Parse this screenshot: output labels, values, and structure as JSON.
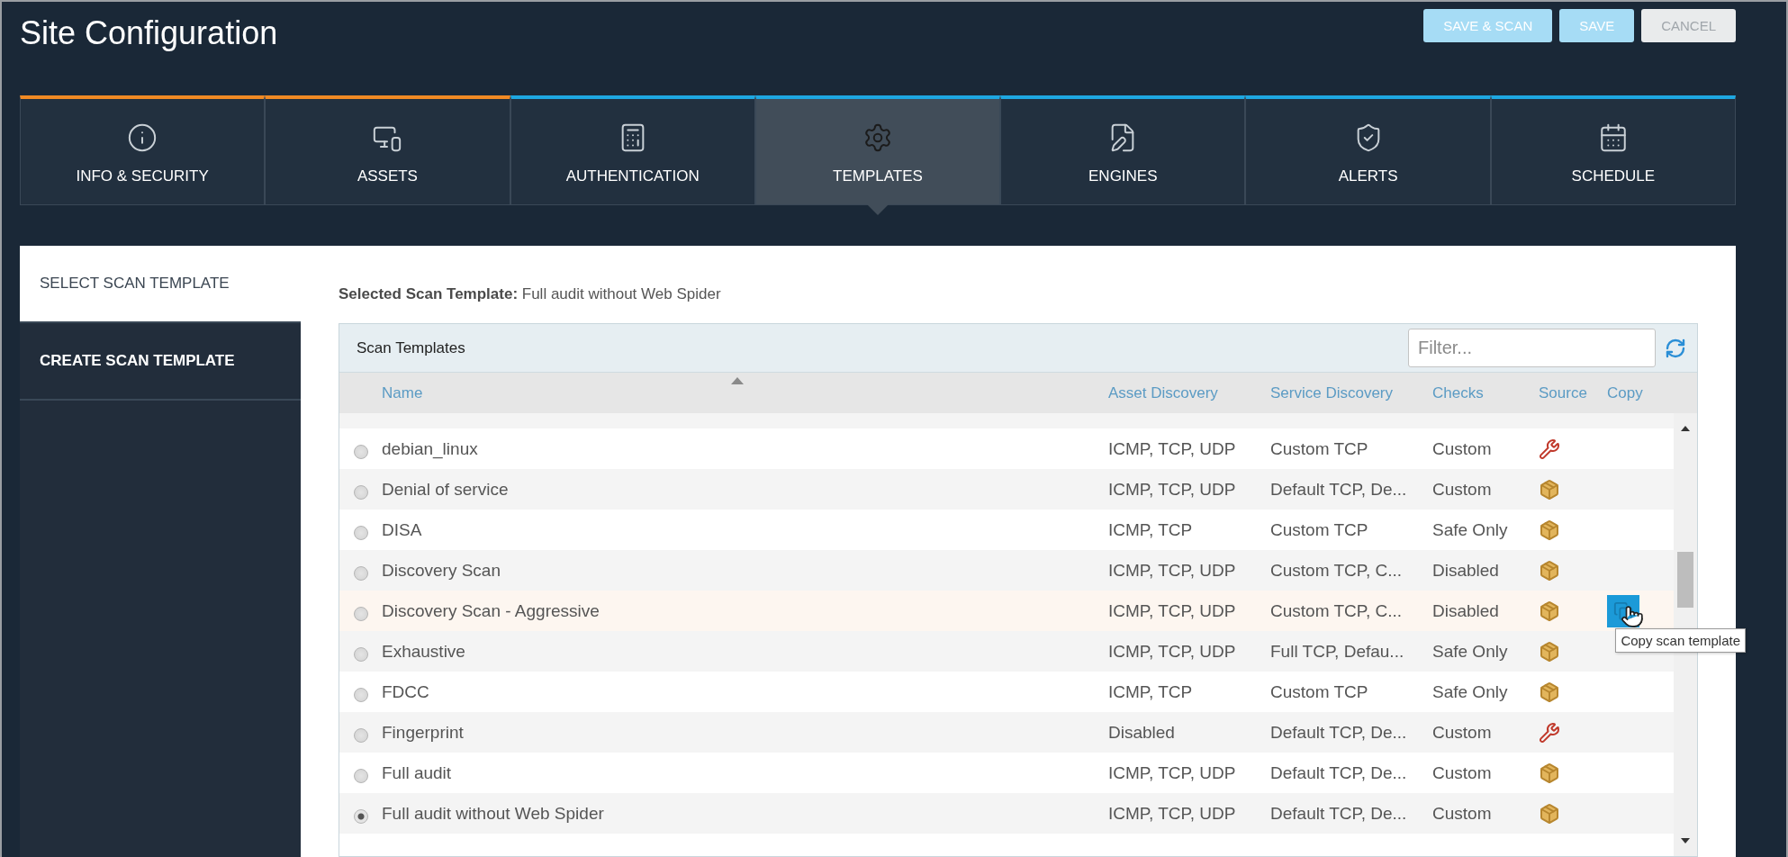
{
  "title": "Site Configuration",
  "actions": [
    {
      "label": "SAVE & SCAN",
      "kind": "primary"
    },
    {
      "label": "SAVE",
      "kind": "primary"
    },
    {
      "label": "CANCEL",
      "kind": "secondary"
    }
  ],
  "tabs": [
    {
      "label": "INFO & SECURITY",
      "selected": false,
      "color": "#f08a24"
    },
    {
      "label": "ASSETS",
      "selected": false,
      "color": "#f08a24"
    },
    {
      "label": "AUTHENTICATION",
      "selected": false,
      "color": "#1ea7e1"
    },
    {
      "label": "TEMPLATES",
      "selected": true,
      "color": "#1ea7e1"
    },
    {
      "label": "ENGINES",
      "selected": false,
      "color": "#1ea7e1"
    },
    {
      "label": "ALERTS",
      "selected": false,
      "color": "#1ea7e1"
    },
    {
      "label": "SCHEDULE",
      "selected": false,
      "color": "#1ea7e1"
    }
  ],
  "sidebar": {
    "items": [
      {
        "label": "SELECT SCAN TEMPLATE",
        "selected": true
      },
      {
        "label": "CREATE SCAN TEMPLATE",
        "selected": false
      }
    ]
  },
  "selected_template": "**Selected Scan Template:** Full audit without Web Spider",
  "table": {
    "title": "Scan Templates",
    "filter": {
      "placeholder": "Filter..."
    },
    "columns": [
      {
        "label": "Name",
        "sorted": true
      },
      {
        "label": "Asset Discovery",
        "sorted": false
      },
      {
        "label": "Service Discovery",
        "sorted": false
      },
      {
        "label": "Checks",
        "sorted": false
      },
      {
        "label": "Source",
        "sorted": false
      },
      {
        "label": "Copy",
        "sorted": false
      }
    ],
    "rows": [
      {
        "name": "debian_linux",
        "asset_discovery": "ICMP, TCP, UDP",
        "service_discovery": "Custom TCP",
        "checks": "Custom",
        "kind": "custom",
        "selected": false,
        "hovered": false
      },
      {
        "name": "Denial of service",
        "asset_discovery": "ICMP, TCP, UDP",
        "service_discovery": "Default TCP, De...",
        "checks": "Custom",
        "kind": "builtin",
        "selected": false,
        "hovered": false
      },
      {
        "name": "DISA",
        "asset_discovery": "ICMP, TCP",
        "service_discovery": "Custom TCP",
        "checks": "Safe Only",
        "kind": "builtin",
        "selected": false,
        "hovered": false
      },
      {
        "name": "Discovery Scan",
        "asset_discovery": "ICMP, TCP, UDP",
        "service_discovery": "Custom TCP, C...",
        "checks": "Disabled",
        "kind": "builtin",
        "selected": false,
        "hovered": false
      },
      {
        "name": "Discovery Scan - Aggressive",
        "asset_discovery": "ICMP, TCP, UDP",
        "service_discovery": "Custom TCP, C...",
        "checks": "Disabled",
        "kind": "builtin",
        "selected": false,
        "hovered": true
      },
      {
        "name": "Exhaustive",
        "asset_discovery": "ICMP, TCP, UDP",
        "service_discovery": "Full TCP, Defau...",
        "checks": "Safe Only",
        "kind": "builtin",
        "selected": false,
        "hovered": false
      },
      {
        "name": "FDCC",
        "asset_discovery": "ICMP, TCP",
        "service_discovery": "Custom TCP",
        "checks": "Safe Only",
        "kind": "builtin",
        "selected": false,
        "hovered": false
      },
      {
        "name": "Fingerprint",
        "asset_discovery": "Disabled",
        "service_discovery": "Default TCP, De...",
        "checks": "Custom",
        "kind": "custom",
        "selected": false,
        "hovered": false
      },
      {
        "name": "Full audit",
        "asset_discovery": "ICMP, TCP, UDP",
        "service_discovery": "Default TCP, De...",
        "checks": "Custom",
        "kind": "builtin",
        "selected": false,
        "hovered": false
      },
      {
        "name": "Full audit without Web Spider",
        "asset_discovery": "ICMP, TCP, UDP",
        "service_discovery": "Default TCP, De...",
        "checks": "Custom",
        "kind": "builtin",
        "selected": true,
        "hovered": false
      }
    ],
    "tooltip": "Copy scan template"
  }
}
